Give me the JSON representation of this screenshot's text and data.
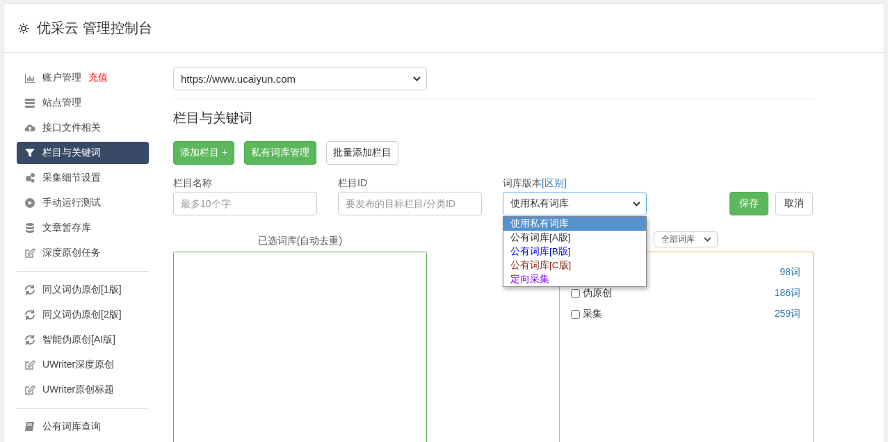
{
  "header": {
    "title": "优采云 管理控制台"
  },
  "sidebar": {
    "items": [
      {
        "label": "账户管理",
        "badge": "充值",
        "selected": false,
        "divider_after": false
      },
      {
        "label": "站点管理",
        "selected": false,
        "divider_after": false
      },
      {
        "label": "接口文件相关",
        "selected": false,
        "divider_after": false
      },
      {
        "label": "栏目与关键词",
        "selected": true,
        "divider_after": false
      },
      {
        "label": "采集细节设置",
        "selected": false,
        "divider_after": false
      },
      {
        "label": "手动运行测试",
        "selected": false,
        "divider_after": false
      },
      {
        "label": "文章暂存库",
        "selected": false,
        "divider_after": false
      },
      {
        "label": "深度原创任务",
        "selected": false,
        "divider_after": true
      },
      {
        "label": "同义词伪原创[1版]",
        "selected": false,
        "divider_after": false
      },
      {
        "label": "同义词伪原创[2版]",
        "selected": false,
        "divider_after": false
      },
      {
        "label": "智能伪原创[AI版]",
        "selected": false,
        "divider_after": false
      },
      {
        "label": "UWriter深度原创",
        "selected": false,
        "divider_after": false
      },
      {
        "label": "UWriter原创标题",
        "selected": false,
        "divider_after": true
      },
      {
        "label": "公有词库查询",
        "selected": false,
        "divider_after": false
      }
    ]
  },
  "site_select": {
    "value": "https://www.ucaiyun.com"
  },
  "section_title": "栏目与关键词",
  "buttons": [
    {
      "label": "添加栏目 +",
      "kind": "success"
    },
    {
      "label": "私有词库管理",
      "kind": "success"
    },
    {
      "label": "批量添加栏目",
      "kind": "default"
    }
  ],
  "form": {
    "name_label": "栏目名称",
    "name_placeholder": "最多10个字",
    "id_label": "栏目ID",
    "id_placeholder": "要发布的目标栏目/分类ID",
    "library_label": "词库版本",
    "library_link": "[区别]",
    "library_value": "使用私有词库",
    "save": "保存",
    "cancel": "取消"
  },
  "library_options": [
    {
      "label": "使用私有词库",
      "selected": true
    },
    {
      "label": "公有词库[A版]",
      "selected": false,
      "color": "#333333"
    },
    {
      "label": "公有词库[B版]",
      "selected": false,
      "color": "#0000ff"
    },
    {
      "label": "公有词库[C版]",
      "selected": false,
      "color": "#8b2a1a"
    },
    {
      "label": "定向采集",
      "selected": false,
      "color": "#8000ff"
    }
  ],
  "selected_panel": {
    "title": "已选词库(自动去重)"
  },
  "library_panel": {
    "filter": "全部词库",
    "rows": [
      {
        "count": "98词"
      },
      {
        "name": "伪原创",
        "count": "186词",
        "checked": false
      },
      {
        "name": "采集",
        "count": "259词",
        "checked": false
      }
    ]
  }
}
